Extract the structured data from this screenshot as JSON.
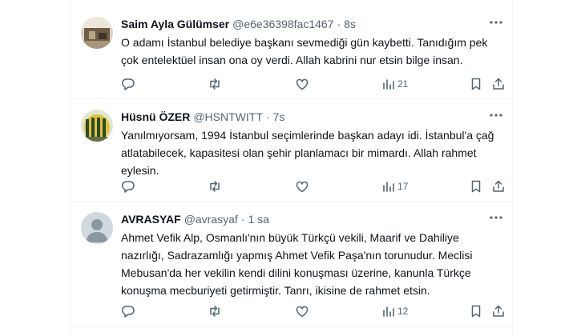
{
  "tweets": [
    {
      "name": "Saim Ayla Gülümser",
      "handle": "@e6e36398fac1467",
      "dot": "·",
      "time": "8s",
      "text": "O adamı İstanbul belediye başkanı sevmediği gün kaybetti. Tanıdığım pek çok entelektüel insan ona oy verdi. Allah kabrini nur etsin bilge insan.",
      "views": "21"
    },
    {
      "name": "Hüsnü ÖZER",
      "handle": "@HSNTWITT",
      "dot": "·",
      "time": "7s",
      "text": "Yanılmıyorsam, 1994 İstanbul seçimlerinde başkan adayı idi. İstanbul'a çağ atlatabilecek, kapasitesi olan şehir planlamacı bir mimardı. Allah rahmet eylesin.",
      "views": "17"
    },
    {
      "name": "AVRASYAF",
      "handle": "@avrasyaf",
      "dot": "·",
      "time": "1 sa",
      "text": "Ahmet Vefik Alp, Osmanlı'nın büyük Türkçü vekili, Maarif ve Dahiliye nazırlığı, Sadrazamlığı yapmış Ahmet Vefik Paşa'nın torunudur. Meclisi Mebusan'da her vekilin kendi dilini konuşması üzerine, kanunla Türkçe konuşma mecburiyeti getirmiştir. Tanrı, ikisine de rahmet etsin.",
      "views": "12"
    }
  ],
  "icons": {
    "more": "more-horizontal-icon",
    "reply": "reply-icon",
    "retweet": "retweet-icon",
    "like": "heart-icon",
    "views": "views-icon",
    "bookmark": "bookmark-icon",
    "share": "share-icon"
  },
  "colors": {
    "text": "#0f1419",
    "secondary": "#536471",
    "border": "#eff3f4"
  }
}
